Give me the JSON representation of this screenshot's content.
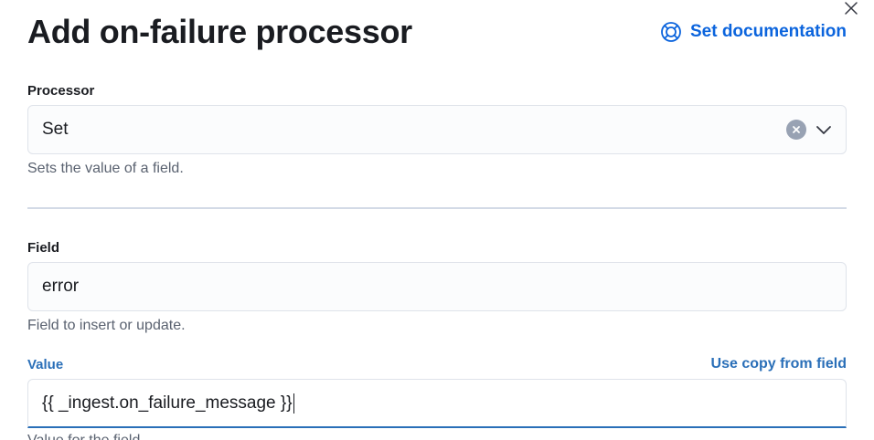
{
  "header": {
    "title": "Add on-failure processor",
    "doc_link_label": "Set documentation",
    "close_icon": "close-icon",
    "doc_icon": "lifebuoy-icon"
  },
  "processor": {
    "label": "Processor",
    "value": "Set",
    "help": "Sets the value of a field."
  },
  "field": {
    "label": "Field",
    "value": "error",
    "help": "Field to insert or update."
  },
  "value_field": {
    "label": "Value",
    "copy_link": "Use copy from field",
    "value": "{{ _ingest.on_failure_message }}",
    "help": "Value for the field."
  },
  "colors": {
    "accent": "#0b64dd",
    "focus": "#2a6fb8",
    "text": "#1a1c21",
    "muted": "#5a6270"
  }
}
